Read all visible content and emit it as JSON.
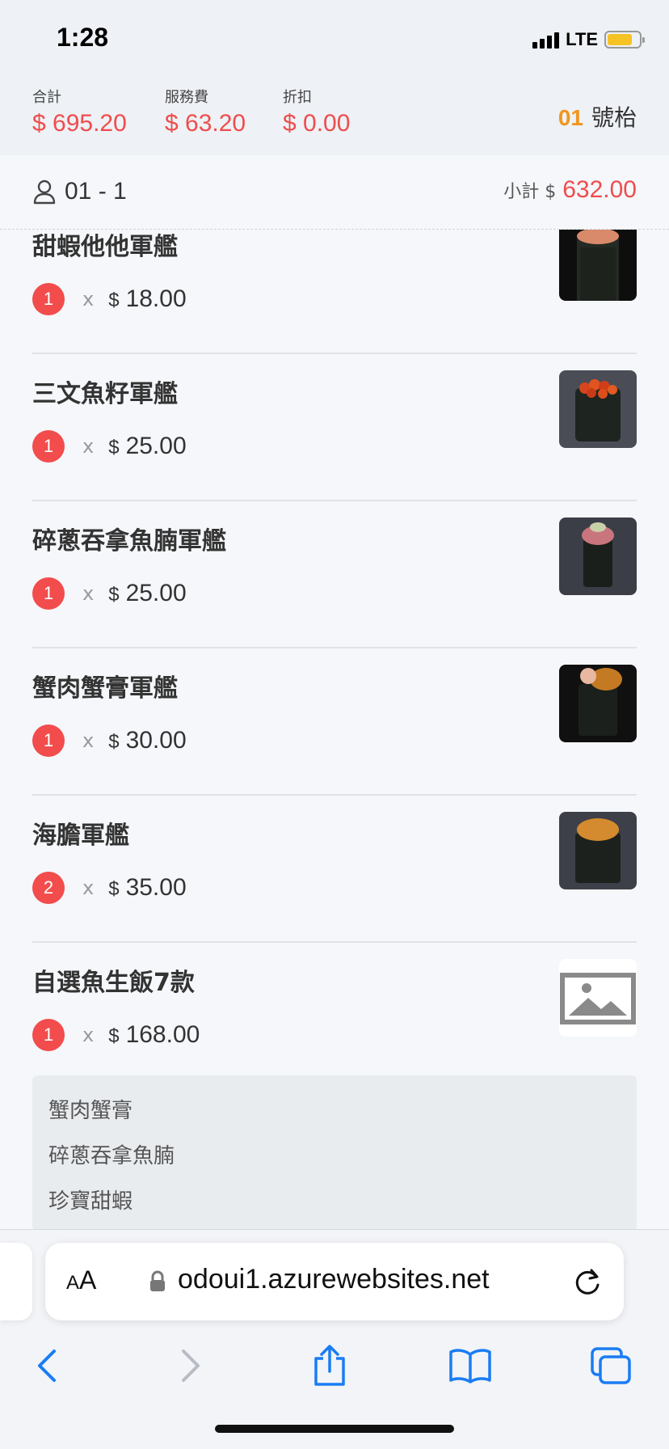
{
  "status_bar": {
    "time": "1:28",
    "network": "LTE"
  },
  "summary": {
    "total_label": "合計",
    "total_value": "$ 695.20",
    "service_label": "服務費",
    "service_value": "$ 63.20",
    "discount_label": "折扣",
    "discount_value": "$ 0.00",
    "table_number": "01",
    "table_suffix": "號枱"
  },
  "seat": {
    "label": "01 - 1",
    "subtotal_label": "小計 $",
    "subtotal_value": "632.00"
  },
  "items": [
    {
      "name": "甜蝦他他軍艦",
      "qty": "1",
      "times": "x",
      "currency": "$",
      "price": "18.00"
    },
    {
      "name": "三文魚籽軍艦",
      "qty": "1",
      "times": "x",
      "currency": "$",
      "price": "25.00"
    },
    {
      "name": "碎蔥吞拿魚腩軍艦",
      "qty": "1",
      "times": "x",
      "currency": "$",
      "price": "25.00"
    },
    {
      "name": "蟹肉蟹膏軍艦",
      "qty": "1",
      "times": "x",
      "currency": "$",
      "price": "30.00"
    },
    {
      "name": "海膽軍艦",
      "qty": "2",
      "times": "x",
      "currency": "$",
      "price": "35.00"
    },
    {
      "name": "自選魚生飯7款",
      "qty": "1",
      "times": "x",
      "currency": "$",
      "price": "168.00",
      "sub_items": [
        "蟹肉蟹膏",
        "碎蔥吞拿魚腩",
        "珍寶甜蝦"
      ]
    }
  ],
  "browser": {
    "text_size_label_small": "A",
    "text_size_label_large": "A",
    "url": "odoui1.azurewebsites.net"
  },
  "colors": {
    "accent_red": "#ee4d4d",
    "table_orange": "#f0961e",
    "ios_blue": "#1a7cf4"
  },
  "icons": [
    "person-icon",
    "lock-icon",
    "reload-icon",
    "back-icon",
    "forward-icon",
    "share-icon",
    "bookmarks-icon",
    "tabs-icon",
    "image-placeholder-icon"
  ]
}
